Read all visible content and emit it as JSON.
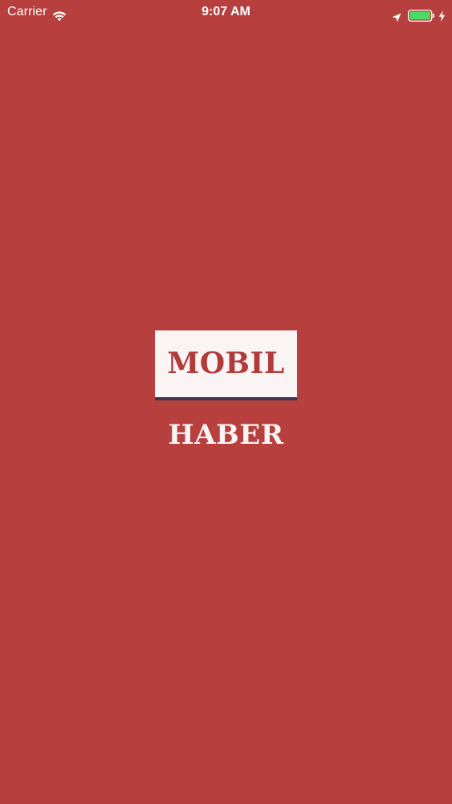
{
  "status_bar": {
    "carrier": "Carrier",
    "time": "9:07 AM",
    "icons": {
      "wifi": "wifi-icon",
      "location": "location-arrow-icon",
      "battery": "battery-icon",
      "charging": "charging-bolt-icon"
    },
    "battery_color": "#4cd964"
  },
  "splash": {
    "logo_top": "MOBIL",
    "logo_bottom": "HABER",
    "background_color": "#b73f3d",
    "logo_box_color": "#fbf4f4",
    "logo_text_color": "#b23b3a",
    "logo_underline_color": "#3f3550"
  }
}
